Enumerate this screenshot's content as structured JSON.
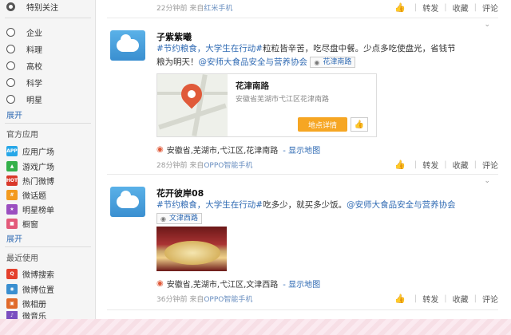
{
  "sidebar": {
    "top_item": "特别关注",
    "groups": [
      "企业",
      "料理",
      "高校",
      "科学",
      "明星"
    ],
    "expand_label": "展开",
    "apps_heading": "官方应用",
    "apps": [
      {
        "label": "应用广场",
        "color": "#27a7e8",
        "icon": "app-square-icon"
      },
      {
        "label": "游戏广场",
        "color": "#34b04a",
        "icon": "game-icon"
      },
      {
        "label": "热门微博",
        "color": "#d9382a",
        "icon": "hot-icon"
      },
      {
        "label": "微话题",
        "color": "#f39a1e",
        "icon": "topic-icon"
      },
      {
        "label": "明星榜单",
        "color": "#9b4fc0",
        "icon": "star-rank-icon"
      },
      {
        "label": "橱窗",
        "color": "#e35a7a",
        "icon": "shop-icon"
      }
    ],
    "apps_expand_label": "展开",
    "recent_heading": "最近使用",
    "recent": [
      {
        "label": "微博搜索",
        "color": "#e4402c",
        "icon": "search-icon"
      },
      {
        "label": "微博位置",
        "color": "#3a8fd0",
        "icon": "location-icon"
      },
      {
        "label": "微相册",
        "color": "#e06a2a",
        "icon": "album-icon"
      },
      {
        "label": "微音乐",
        "color": "#7a4fc0",
        "icon": "music-icon"
      }
    ]
  },
  "actions": {
    "forward": "转发",
    "favorite": "收藏",
    "comment": "评论"
  },
  "posts": [
    {
      "time": "22分钟前",
      "from": "来自",
      "device": "红米手机"
    },
    {
      "user": "子紫紫曦",
      "tag": "#节约粮食，大学生在行动#",
      "text_line1": "粒粒皆辛苦，吃尽盘中餐。少点多吃使盘光，省钱节",
      "text_line2": "粮为明天！",
      "mention": "@安师大食品安全与营养协会",
      "loc_chip": "花津南路",
      "map_title": "花津南路",
      "map_addr": "安徽省芜湖市弋江区花津南路",
      "map_button": "地点详情",
      "location": "安徽省,芜湖市,弋江区,花津南路",
      "show_map": "- 显示地图",
      "time": "28分钟前",
      "from": "来自",
      "device": "OPPO智能手机"
    },
    {
      "user": "花开彼岸08",
      "tag": "#节约粮食，大学生在行动#",
      "text_line1": "吃多少，就买多少饭。",
      "mention": "@安师大食品安全与营养协会",
      "loc_chip": "文津西路",
      "location": "安徽省,芜湖市,弋江区,文津西路",
      "show_map": "- 显示地图",
      "time": "36分钟前",
      "from": "来自",
      "device": "OPPO智能手机"
    }
  ]
}
